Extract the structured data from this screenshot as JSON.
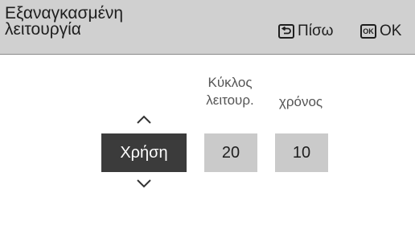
{
  "header": {
    "title_line1": "Εξαναγκασμένη",
    "title_line2": "λειτουργία",
    "back_label": "Πίσω",
    "ok_icon_text": "OK",
    "ok_label": "OK"
  },
  "columns": {
    "cycle_header_line1": "Κύκλος",
    "cycle_header_line2": "λειτουρ.",
    "time_header": "χρόνος"
  },
  "values": {
    "usage": "Χρήση",
    "cycle": "20",
    "time": "10"
  },
  "colors": {
    "header_bg": "#d0d0d0",
    "selected_bg": "#3b3b3b",
    "field_bg": "#cacaca",
    "text": "#1e1e1e"
  },
  "icons": [
    "back-icon",
    "ok-icon",
    "chevron-up-icon",
    "chevron-down-icon"
  ]
}
